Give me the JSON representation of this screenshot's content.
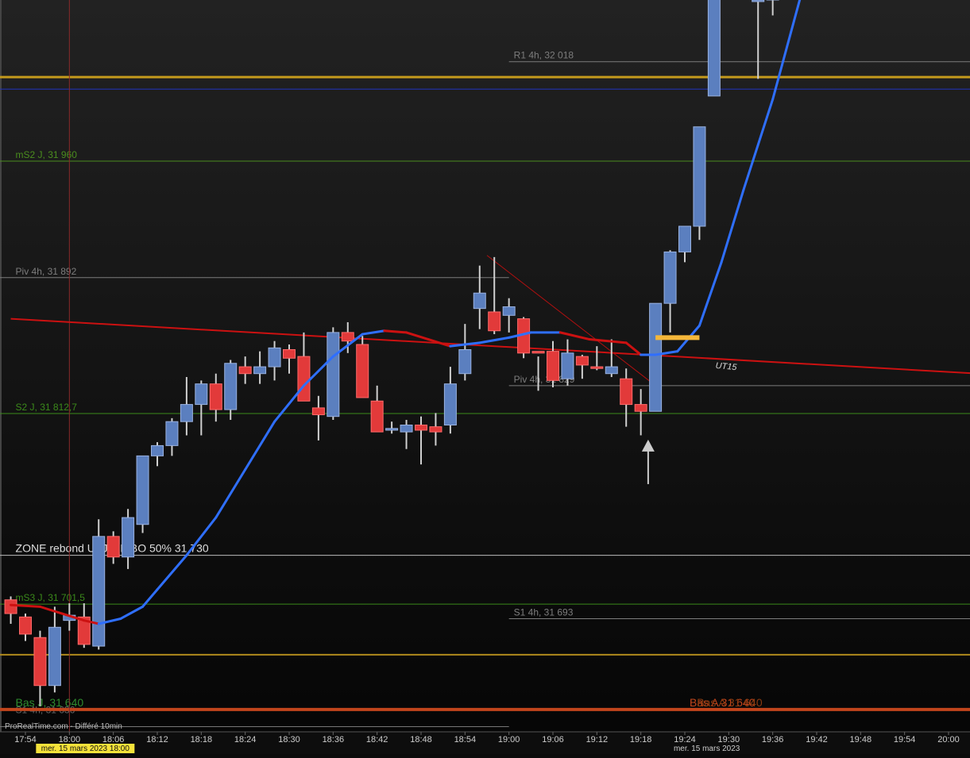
{
  "chart_data": {
    "type": "candlestick",
    "instrument_interval_note": "",
    "y_range": [
      31627,
      32054
    ],
    "x_time_labels": [
      "17:54",
      "18:00",
      "18:06",
      "18:12",
      "18:18",
      "18:24",
      "18:30",
      "18:36",
      "18:42",
      "18:48",
      "18:54",
      "19:00",
      "19:06",
      "19:12",
      "19:18",
      "19:24",
      "19:30",
      "19:36",
      "19:42",
      "19:48",
      "19:54",
      "20:00"
    ],
    "date_labels": [
      {
        "text": "mer. 15 mars 2023 18:00",
        "at_time": "18:00",
        "highlight": true
      },
      {
        "text": "mer. 15 mars 2023",
        "at_time": "19:27",
        "highlight": false
      }
    ],
    "footer_text": "ProRealTime.com - Différé 10min",
    "candles": [
      {
        "t": "17:52",
        "o": 31704,
        "h": 31706,
        "l": 31690,
        "c": 31696
      },
      {
        "t": "17:54",
        "o": 31694,
        "h": 31696,
        "l": 31680,
        "c": 31684
      },
      {
        "t": "17:56",
        "o": 31682,
        "h": 31686,
        "l": 31642,
        "c": 31654
      },
      {
        "t": "17:58",
        "o": 31654,
        "h": 31700,
        "l": 31650,
        "c": 31688
      },
      {
        "t": "18:00",
        "o": 31692,
        "h": 31702,
        "l": 31686,
        "c": 31695
      },
      {
        "t": "18:02",
        "o": 31694,
        "h": 31702,
        "l": 31676,
        "c": 31678
      },
      {
        "t": "18:04",
        "o": 31677,
        "h": 31751,
        "l": 31675,
        "c": 31741
      },
      {
        "t": "18:06",
        "o": 31741,
        "h": 31744,
        "l": 31725,
        "c": 31729
      },
      {
        "t": "18:08",
        "o": 31729,
        "h": 31757,
        "l": 31722,
        "c": 31752
      },
      {
        "t": "18:10",
        "o": 31748,
        "h": 31788,
        "l": 31743,
        "c": 31788
      },
      {
        "t": "18:12",
        "o": 31788,
        "h": 31796,
        "l": 31782,
        "c": 31794
      },
      {
        "t": "18:14",
        "o": 31794,
        "h": 31810,
        "l": 31788,
        "c": 31808
      },
      {
        "t": "18:16",
        "o": 31808,
        "h": 31834,
        "l": 31800,
        "c": 31818
      },
      {
        "t": "18:18",
        "o": 31818,
        "h": 31832,
        "l": 31800,
        "c": 31830
      },
      {
        "t": "18:20",
        "o": 31830,
        "h": 31836,
        "l": 31808,
        "c": 31815
      },
      {
        "t": "18:22",
        "o": 31815,
        "h": 31844,
        "l": 31809,
        "c": 31842
      },
      {
        "t": "18:24",
        "o": 31840,
        "h": 31846,
        "l": 31830,
        "c": 31836
      },
      {
        "t": "18:26",
        "o": 31836,
        "h": 31849,
        "l": 31830,
        "c": 31840
      },
      {
        "t": "18:28",
        "o": 31840,
        "h": 31855,
        "l": 31832,
        "c": 31851
      },
      {
        "t": "18:30",
        "o": 31850,
        "h": 31853,
        "l": 31836,
        "c": 31845
      },
      {
        "t": "18:32",
        "o": 31846,
        "h": 31860,
        "l": 31820,
        "c": 31820
      },
      {
        "t": "18:34",
        "o": 31816,
        "h": 31823,
        "l": 31797,
        "c": 31812
      },
      {
        "t": "18:36",
        "o": 31811,
        "h": 31863,
        "l": 31809,
        "c": 31860
      },
      {
        "t": "18:38",
        "o": 31860,
        "h": 31866,
        "l": 31848,
        "c": 31855
      },
      {
        "t": "18:40",
        "o": 31853,
        "h": 31858,
        "l": 31822,
        "c": 31822
      },
      {
        "t": "18:42",
        "o": 31820,
        "h": 31829,
        "l": 31802,
        "c": 31802
      },
      {
        "t": "18:44",
        "o": 31803,
        "h": 31808,
        "l": 31801,
        "c": 31804
      },
      {
        "t": "18:46",
        "o": 31802,
        "h": 31809,
        "l": 31792,
        "c": 31806
      },
      {
        "t": "18:48",
        "o": 31806,
        "h": 31811,
        "l": 31783,
        "c": 31803
      },
      {
        "t": "18:50",
        "o": 31805,
        "h": 31813,
        "l": 31794,
        "c": 31802
      },
      {
        "t": "18:52",
        "o": 31806,
        "h": 31840,
        "l": 31801,
        "c": 31830
      },
      {
        "t": "18:54",
        "o": 31836,
        "h": 31865,
        "l": 31832,
        "c": 31850
      },
      {
        "t": "18:56",
        "o": 31874,
        "h": 31899,
        "l": 31862,
        "c": 31883
      },
      {
        "t": "18:58",
        "o": 31872,
        "h": 31904,
        "l": 31859,
        "c": 31861
      },
      {
        "t": "19:00",
        "o": 31870,
        "h": 31880,
        "l": 31860,
        "c": 31875
      },
      {
        "t": "19:02",
        "o": 31868,
        "h": 31869,
        "l": 31845,
        "c": 31848
      },
      {
        "t": "19:04",
        "o": 31849,
        "h": 31846,
        "l": 31826,
        "c": 31848
      },
      {
        "t": "19:06",
        "o": 31849,
        "h": 31855,
        "l": 31828,
        "c": 31832
      },
      {
        "t": "19:08",
        "o": 31833,
        "h": 31856,
        "l": 31829,
        "c": 31848
      },
      {
        "t": "19:10",
        "o": 31846,
        "h": 31847,
        "l": 31833,
        "c": 31841
      },
      {
        "t": "19:12",
        "o": 31840,
        "h": 31852,
        "l": 31838,
        "c": 31839
      },
      {
        "t": "19:14",
        "o": 31836,
        "h": 31856,
        "l": 31834,
        "c": 31840
      },
      {
        "t": "19:16",
        "o": 31833,
        "h": 31839,
        "l": 31805,
        "c": 31818
      },
      {
        "t": "19:18",
        "o": 31818,
        "h": 31827,
        "l": 31800,
        "c": 31814
      },
      {
        "t": "19:20",
        "o": 31814,
        "h": 31877,
        "l": 31830,
        "c": 31877
      },
      {
        "t": "19:22",
        "o": 31877,
        "h": 31908,
        "l": 31860,
        "c": 31907
      },
      {
        "t": "19:24",
        "o": 31907,
        "h": 31922,
        "l": 31901,
        "c": 31922
      },
      {
        "t": "19:26",
        "o": 31922,
        "h": 31980,
        "l": 31914,
        "c": 31980
      },
      {
        "t": "19:28",
        "o": 31998,
        "h": 32060,
        "l": 31998,
        "c": 32060
      },
      {
        "t": "19:34",
        "o": 32054,
        "h": 32060,
        "l": 32008,
        "c": 32054
      },
      {
        "t": "19:36",
        "o": 32054,
        "h": 32060,
        "l": 32045,
        "c": 32056
      }
    ],
    "moving_average": {
      "color_rising": "#2f6fff",
      "color_falling": "#cc1111",
      "points": [
        {
          "t": "17:52",
          "v": 31701
        },
        {
          "t": "17:56",
          "v": 31700
        },
        {
          "t": "17:59",
          "v": 31696
        },
        {
          "t": "18:02",
          "v": 31692
        },
        {
          "t": "18:04",
          "v": 31690
        },
        {
          "t": "18:07",
          "v": 31693
        },
        {
          "t": "18:10",
          "v": 31700
        },
        {
          "t": "18:12",
          "v": 31710
        },
        {
          "t": "18:16",
          "v": 31730
        },
        {
          "t": "18:20",
          "v": 31752
        },
        {
          "t": "18:24",
          "v": 31780
        },
        {
          "t": "18:28",
          "v": 31808
        },
        {
          "t": "18:32",
          "v": 31829
        },
        {
          "t": "18:36",
          "v": 31846
        },
        {
          "t": "18:40",
          "v": 31859
        },
        {
          "t": "18:43",
          "v": 31861
        },
        {
          "t": "18:46",
          "v": 31860
        },
        {
          "t": "18:49",
          "v": 31856
        },
        {
          "t": "18:52",
          "v": 31852
        },
        {
          "t": "18:56",
          "v": 31854
        },
        {
          "t": "19:00",
          "v": 31857
        },
        {
          "t": "19:03",
          "v": 31860
        },
        {
          "t": "19:07",
          "v": 31860
        },
        {
          "t": "19:11",
          "v": 31856
        },
        {
          "t": "19:16",
          "v": 31854
        },
        {
          "t": "19:18",
          "v": 31847
        },
        {
          "t": "19:20",
          "v": 31847
        },
        {
          "t": "19:23",
          "v": 31849
        },
        {
          "t": "19:26",
          "v": 31864
        },
        {
          "t": "19:29",
          "v": 31901
        },
        {
          "t": "19:32",
          "v": 31943
        },
        {
          "t": "19:36",
          "v": 31996
        },
        {
          "t": "19:40",
          "v": 32059
        }
      ]
    },
    "horizontal_levels": [
      {
        "label": "R1 4h, 32 018",
        "value": 32018,
        "color": "#7d7d7d",
        "label_at_time": "19:00",
        "from_time": "19:00",
        "width": 1
      },
      {
        "label": "",
        "value": 32009,
        "color": "#c49a1c",
        "from_time": null,
        "width": 3
      },
      {
        "label": "",
        "value": 32002,
        "color": "#2233bb",
        "from_time": null,
        "width": 1
      },
      {
        "label": "mS2 J, 31 960",
        "value": 31960,
        "color": "#4a8d1e",
        "label_at_time": "17:52",
        "from_time": null,
        "width": 1
      },
      {
        "label": "Piv 4h, 31 892",
        "value": 31892,
        "color": "#7d7d7d",
        "label_at_time": "17:52",
        "from_time": null,
        "to_time": "19:00",
        "width": 1
      },
      {
        "label": "Piv 4h, 31 829",
        "value": 31829,
        "color": "#7d7d7d",
        "label_at_time": "19:00",
        "from_time": "19:00",
        "width": 1
      },
      {
        "label": "S2 J, 31 812,7",
        "value": 31812.7,
        "color": "#3b8a1a",
        "label_at_time": "17:52",
        "from_time": null,
        "width": 1
      },
      {
        "label": "ZONE rebond UTJ + FIBO 50% 31 730",
        "value": 31730,
        "color": "#bbbbbb",
        "label_at_time": "17:52",
        "from_time": null,
        "width": 1
      },
      {
        "label": "mS3 J, 31 701,5",
        "value": 31701.5,
        "color": "#3b8a1a",
        "label_at_time": "17:52",
        "from_time": null,
        "width": 1
      },
      {
        "label": "S1 4h, 31 693",
        "value": 31693,
        "color": "#7d7d7d",
        "label_at_time": "19:00",
        "from_time": "19:00",
        "width": 1
      },
      {
        "label": "",
        "value": 31672,
        "color": "#b08a1c",
        "from_time": null,
        "width": 2
      },
      {
        "label": "Bas J, 31 640",
        "value": 31640,
        "color": "#2e8b2e",
        "label_at_time": "17:52",
        "from_time": null,
        "width": 0
      },
      {
        "label": "S1 4h, 31 636",
        "value": 31636,
        "color": "#666666",
        "label_at_time": "17:52",
        "from_time": null,
        "width": 0
      },
      {
        "label": "Bas A 31 640",
        "value": 31640,
        "color": "#c2451c",
        "label_at_time": "19:24",
        "from_time": null,
        "width": 4
      },
      {
        "label": "Bas A 31 640",
        "value": 31640,
        "color": "#8a3a10",
        "label_at_time": "19:25",
        "from_time": null,
        "width": 0
      },
      {
        "label": "",
        "value": 31630,
        "color": "#777777",
        "from_time": null,
        "to_time": "19:00",
        "width": 1
      }
    ],
    "trendline": {
      "label": "UT15",
      "color": "#cc1111",
      "from": {
        "t": "17:52",
        "v": 31868
      },
      "to": {
        "t": "20:04",
        "v": 31836
      }
    },
    "thin_trendline": {
      "color": "#b01010",
      "from": {
        "t": "18:57",
        "v": 31905
      },
      "to": {
        "t": "19:20",
        "v": 31829
      }
    },
    "annotations": {
      "vertical_line_time": "18:00",
      "zone_marker": {
        "from_time": "19:20",
        "to_time": "19:26",
        "value": 31857,
        "color": "#f5b73a"
      },
      "arrow_up": {
        "t": "19:19",
        "v": 31797
      }
    }
  }
}
